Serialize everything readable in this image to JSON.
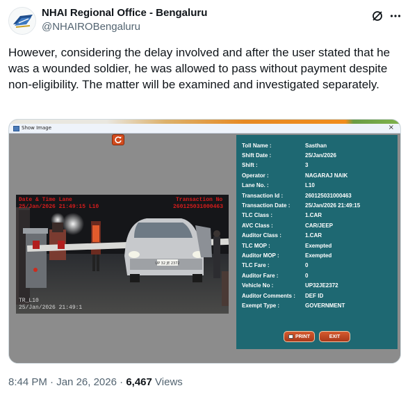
{
  "author": {
    "display_name": "NHAI Regional Office - Bengaluru",
    "handle": "@NHAIROBengaluru",
    "avatar_icon": "nhai-logo-icon"
  },
  "header_actions": {
    "grok_icon": "grok-icon",
    "more_icon": "more-icon"
  },
  "tweet": {
    "text": "However, considering the delay involved and after the user stated that he was a wounded soldier, he was allowed to pass without payment despite non-eligibility. The matter will be examined and investigated separately."
  },
  "media": {
    "window_title": "Show Image",
    "close_glyph": "×",
    "camera": {
      "overlay_top_left": "Date & Time   Lane",
      "overlay_top_left_2": "25/Jan/2026 21:49:15   L10",
      "overlay_tx_label": "Transaction No",
      "overlay_tx_value": "260125031000463",
      "overlay_bottom_lane": "TR_L10",
      "overlay_bottom_date": "25/Jan/2026 21:49:1",
      "plate": "UP 32 JE 2372"
    },
    "details": [
      {
        "label": "Toll Name :",
        "value": "Sasthan"
      },
      {
        "label": "Shift Date :",
        "value": "25/Jan/2026"
      },
      {
        "label": "Shift :",
        "value": "3"
      },
      {
        "label": "Operator :",
        "value": "NAGARAJ NAIK"
      },
      {
        "label": "Lane No. :",
        "value": "L10"
      },
      {
        "label": "Transaction Id :",
        "value": "260125031000463"
      },
      {
        "label": "Transaction Date :",
        "value": "25/Jan/2026 21:49:15"
      },
      {
        "label": "TLC Class :",
        "value": "1.CAR"
      },
      {
        "label": "AVC Class :",
        "value": "CAR/JEEP"
      },
      {
        "label": "Auditor Class :",
        "value": "1.CAR"
      },
      {
        "label": "TLC MOP :",
        "value": "Exempted"
      },
      {
        "label": "Auditor MOP :",
        "value": "Exempted"
      },
      {
        "label": "TLC Fare :",
        "value": "0"
      },
      {
        "label": "Auditor Fare :",
        "value": "0"
      },
      {
        "label": "Vehicle No :",
        "value": "UP32JE2372"
      },
      {
        "label": "Auditor Comments :",
        "value": "DEF ID"
      },
      {
        "label": "Exempt Type :",
        "value": "GOVERNMENT"
      }
    ],
    "buttons": {
      "print": "PRINT",
      "exit": "EXIT"
    },
    "colors": {
      "panel": "#1e6872",
      "button": "#c2461f",
      "window_bg": "#8c8c8c"
    }
  },
  "meta": {
    "time": "8:44 PM",
    "separator": "·",
    "date": "Jan 26, 2026",
    "views_count": "6,467",
    "views_label": "Views"
  }
}
